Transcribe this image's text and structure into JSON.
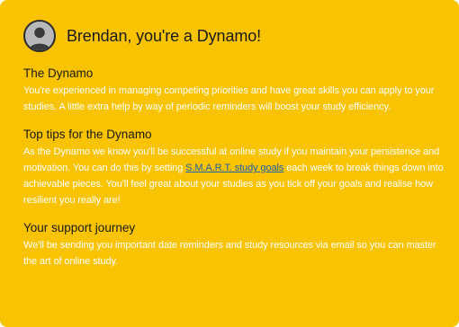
{
  "header": {
    "title": "Brendan, you're a Dynamo!",
    "avatar_icon": "user-avatar-icon"
  },
  "sections": [
    {
      "heading": "The Dynamo",
      "body": "You're experienced in managing competing priorities and have great skills you can apply to your studies. A little extra help by way of periodic reminders will boost your study efficiency."
    },
    {
      "heading": "Top tips for the Dynamo",
      "body_before_link": "As the Dynamo we know you'll be successful at online study if you maintain your persistence and motivation. You can do this by setting ",
      "link_text": "S.M.A.R.T. study goals",
      "body_after_link": " each week to break things down into achievable pieces. You'll feel great about your studies as you tick off your goals and realise how resilient you really are!"
    },
    {
      "heading": "Your support journey",
      "body": "We'll be sending you important date reminders and study resources via email so you can master the art of online study."
    }
  ],
  "colors": {
    "card_background": "#f9c300",
    "body_text": "#ffffff",
    "heading_text": "#1a1a1a",
    "link": "#1f5fa8"
  }
}
